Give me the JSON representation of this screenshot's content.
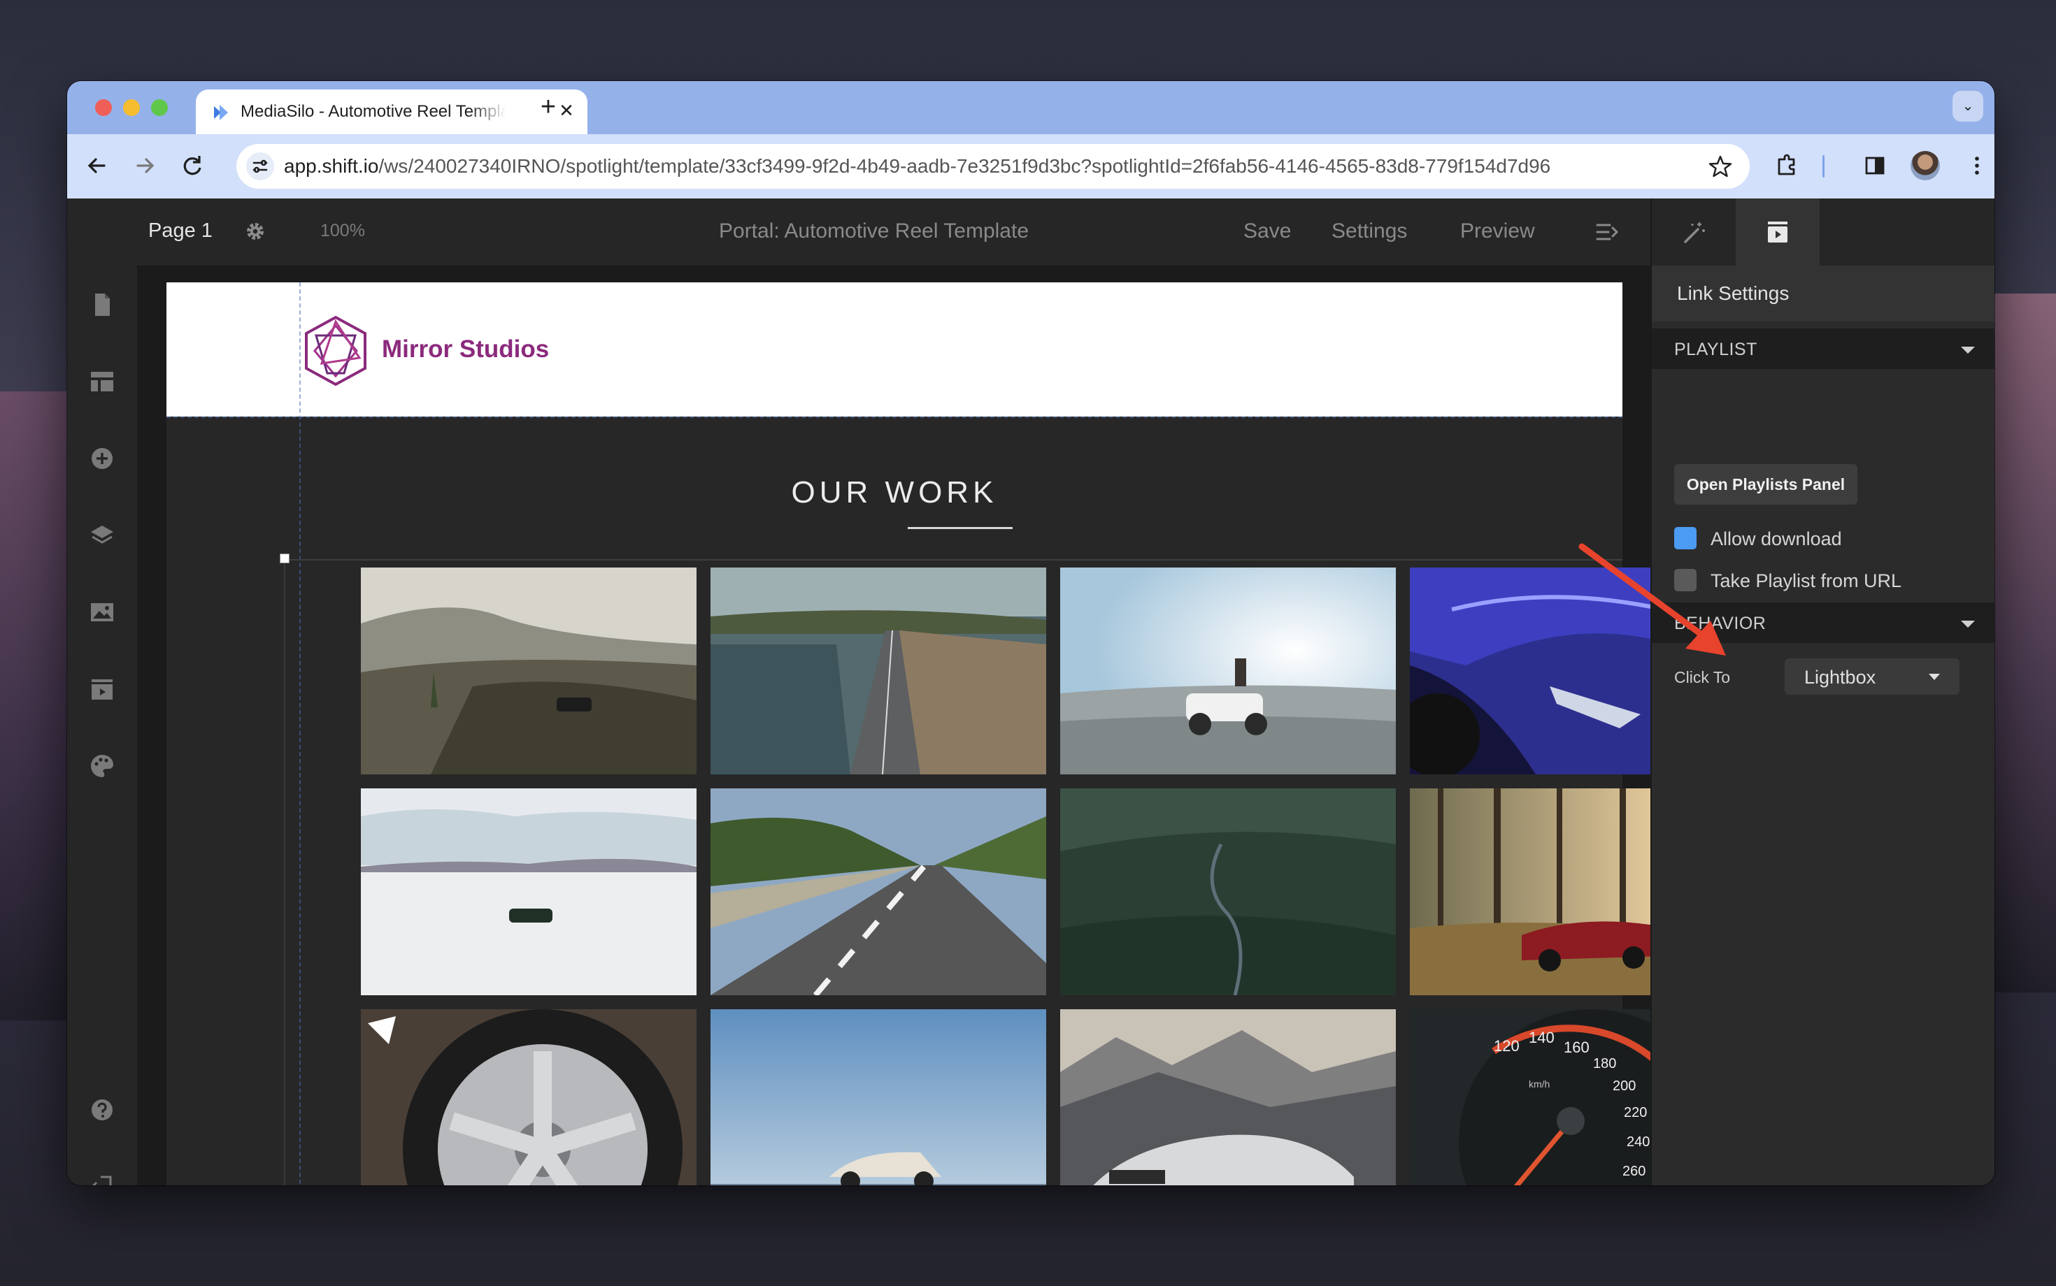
{
  "browser": {
    "tab_title": "MediaSilo - Automotive Reel Template",
    "url_host": "app.shift.io",
    "url_path": "/ws/240027340IRNO/spotlight/template/33cf3499-9f2d-4b49-aadb-7e3251f9d3bc?spotlightId=2f6fab56-4146-4565-83d8-779f154d7d96"
  },
  "editor": {
    "page_label": "Page 1",
    "zoom": "100%",
    "title": "Portal: Automotive Reel Template",
    "actions": {
      "save": "Save",
      "settings": "Settings",
      "preview": "Preview"
    }
  },
  "site": {
    "brand": "Mirror Studios",
    "section_heading": "OUR WORK",
    "brand_color": "#8b2a7d"
  },
  "gallery": {
    "thumbnails": [
      "coastal-hills-suv",
      "causeway-road-aerial",
      "beach-buggy-sunlight",
      "blue-supercar-hood",
      "salt-flats-car",
      "highway-road",
      "forest-winding-road-aerial",
      "red-coupe-forest",
      "alloy-wheel-closeup",
      "white-suv-sky",
      "silver-sedan-mountains",
      "speedometer"
    ],
    "speedo_numbers": [
      "120",
      "140",
      "160",
      "180",
      "200",
      "220",
      "240",
      "260"
    ],
    "speedo_unit": "km/h"
  },
  "panel": {
    "heading": "Link Settings",
    "playlist_section": "PLAYLIST",
    "open_playlists_button": "Open Playlists Panel",
    "allow_download_label": "Allow download",
    "allow_download_checked": true,
    "take_playlist_label": "Take Playlist from URL",
    "take_playlist_checked": false,
    "behavior_section": "BEHAVIOR",
    "click_to_label": "Click To",
    "click_to_value": "Lightbox"
  },
  "annotation": {
    "arrow_color": "#e8432d"
  }
}
